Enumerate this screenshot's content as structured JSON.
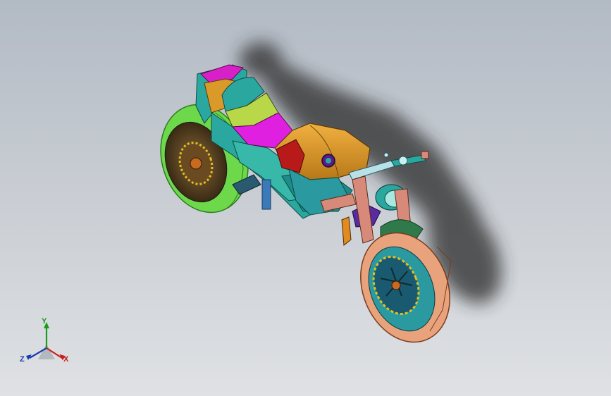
{
  "viewport": {
    "background_top": "#b2bac4",
    "background_bottom": "#dfe1e4",
    "model": "motorcycle"
  },
  "triad": {
    "axes": {
      "y": "Y",
      "z": "Z",
      "x": "X"
    },
    "colors": {
      "x": "#c81e1e",
      "y": "#1a9a1a",
      "z": "#1a3cb0"
    }
  },
  "model_colors": {
    "rear_tire": "#6cd84a",
    "front_tire": "#e8a27c",
    "tank": "#d99a2a",
    "seat_magenta": "#e020e0",
    "seat_lime": "#b8d84a",
    "frame": "#2aa8a0",
    "fork": "#d88a7a",
    "shadow": "#2a2a2a"
  }
}
